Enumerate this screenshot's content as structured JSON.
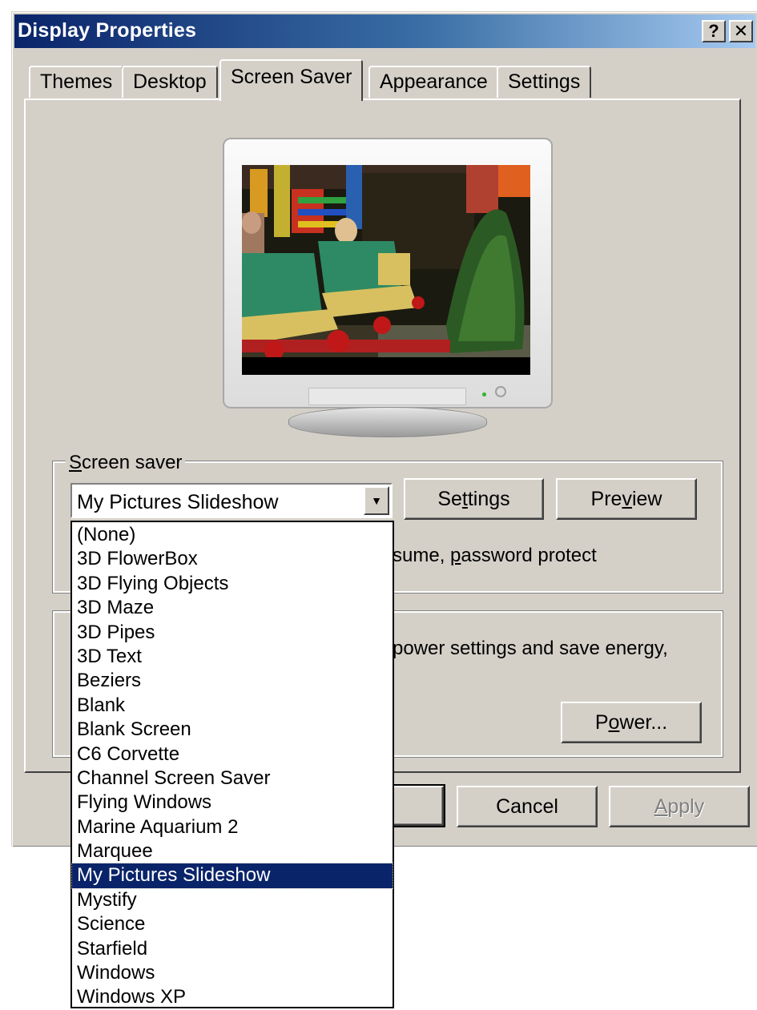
{
  "window": {
    "title": "Display Properties",
    "help_label": "?",
    "close_label": "✕"
  },
  "tabs": [
    {
      "label": "Themes"
    },
    {
      "label": "Desktop"
    },
    {
      "label": "Screen Saver"
    },
    {
      "label": "Appearance"
    },
    {
      "label": "Settings"
    }
  ],
  "screen_saver": {
    "group_label_accel": "S",
    "group_label_rest": "creen saver",
    "selected": "My Pictures Slideshow",
    "settings_pre": "Se",
    "settings_accel": "t",
    "settings_post": "tings",
    "preview_pre": "Pre",
    "preview_accel": "v",
    "preview_post": "iew",
    "resume_pre": "sume, ",
    "resume_accel": "p",
    "resume_post": "assword protect"
  },
  "monitor_power": {
    "text": "power settings and save energy,",
    "power_pre": "P",
    "power_accel": "o",
    "power_post": "wer..."
  },
  "dropdown": {
    "items": [
      "(None)",
      "3D FlowerBox",
      "3D Flying Objects",
      "3D Maze",
      "3D Pipes",
      "3D Text",
      "Beziers",
      "Blank",
      "Blank Screen",
      "C6 Corvette",
      "Channel Screen Saver",
      "Flying Windows",
      "Marine Aquarium 2",
      "Marquee",
      "My Pictures Slideshow",
      "Mystify",
      "Science",
      "Starfield",
      "Windows",
      "Windows XP"
    ],
    "selected_index": 14
  },
  "footer": {
    "cancel_label": "Cancel",
    "apply_accel": "A",
    "apply_post": "pply"
  },
  "colors": {
    "face": "#d4d0c8",
    "title_start": "#0a246a",
    "title_end": "#a6caf0",
    "selection": "#0a246a"
  }
}
